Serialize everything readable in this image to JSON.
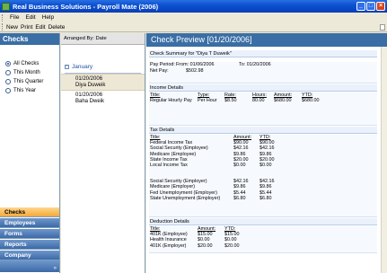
{
  "window": {
    "title": "Real Business Solutions - Payroll Mate (2006)",
    "controls": {
      "minimize": "_",
      "maximize": "□",
      "close": "×"
    }
  },
  "menu": {
    "file": "File",
    "edit": "Edit",
    "help": "Help"
  },
  "toolbar": {
    "new": "New",
    "print": "Print",
    "edit": "Edit",
    "delete": "Delete"
  },
  "leftnav": {
    "header": "Checks",
    "filters": [
      {
        "label": "All Checks",
        "selected": true
      },
      {
        "label": "This Month",
        "selected": false
      },
      {
        "label": "This Quarter",
        "selected": false
      },
      {
        "label": "This Year",
        "selected": false
      }
    ],
    "nav": [
      "Checks",
      "Employees",
      "Forms",
      "Reports",
      "Company"
    ],
    "footer_chevron": "»"
  },
  "list": {
    "arranged_by": "Arranged By: Date",
    "group_label": "January",
    "group_toggle": "−",
    "items": [
      {
        "date": "01/20/2006",
        "name": "Diya Duweik"
      },
      {
        "date": "01/20/2006",
        "name": "Baha Dweik"
      }
    ]
  },
  "preview": {
    "header": "Check Preview [01/20/2006]",
    "summary": {
      "title": "Check Summary for \"Diya T Duweik\"",
      "pay_period_label": "Pay Period:",
      "from": "From: 01/06/2006",
      "to": "To: 01/20/2006",
      "net_pay_label": "Net Pay:",
      "net_pay": "$502.98"
    },
    "income": {
      "title": "Income Details",
      "headers": [
        "Title:",
        "Type:",
        "Rate:",
        "Hours:",
        "Amount:",
        "YTD:"
      ],
      "rows": [
        [
          "Regular Hourly Pay",
          "Per Hour",
          "$8.50",
          "80.00",
          "$680.00",
          "$680.00"
        ]
      ]
    },
    "tax": {
      "title": "Tax Details",
      "headers": [
        "Title:",
        "Amount:",
        "YTD:"
      ],
      "rows": [
        [
          "Federal Income Tax",
          "$90.00",
          "$90.00"
        ],
        [
          "Social Security (Employee)",
          "$42.16",
          "$42.16"
        ],
        [
          "Medicare (Employee)",
          "$9.86",
          "$9.86"
        ],
        [
          "State Income Tax",
          "$20.00",
          "$20.00"
        ],
        [
          "Local Income Tax",
          "$0.00",
          "$0.00"
        ]
      ],
      "employer_rows": [
        [
          "Social Security (Employer)",
          "$42.16",
          "$42.16"
        ],
        [
          "Medicare (Employer)",
          "$9.86",
          "$9.86"
        ],
        [
          "Fed Unemployment (Employer)",
          "$5.44",
          "$5.44"
        ],
        [
          "State Unemployment (Employer)",
          "$6.80",
          "$6.80"
        ]
      ]
    },
    "deduction": {
      "title": "Deduction Details",
      "headers": [
        "Title:",
        "Amount:",
        "YTD:"
      ],
      "rows": [
        [
          "401K (Employee)",
          "$15.00",
          "$15.00"
        ],
        [
          "Health Insurance",
          "$0.00",
          "$0.00"
        ],
        [
          "401K (Employer)",
          "$20.00",
          "$20.00"
        ]
      ]
    }
  }
}
